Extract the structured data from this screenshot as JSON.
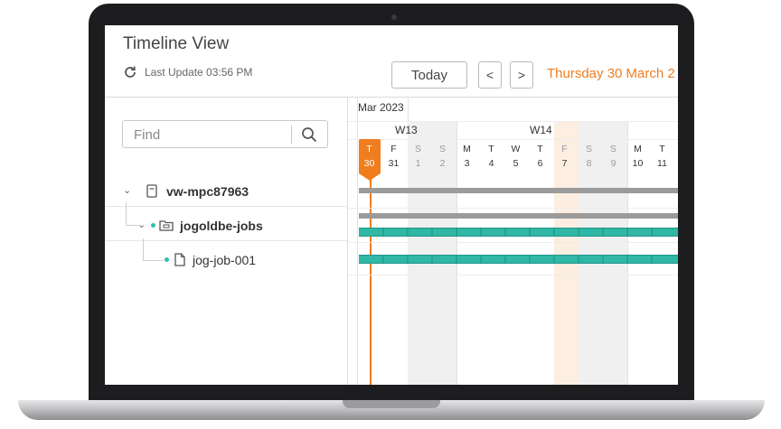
{
  "app": {
    "title": "Timeline View",
    "last_update": "Last Update 03:56 PM",
    "today_button": "Today",
    "prev_button": "<",
    "next_button": ">",
    "current_date": "Thursday 30 March 2"
  },
  "search": {
    "placeholder": "Find"
  },
  "tree": [
    {
      "label": "vw-mpc87963",
      "icon": "server-icon",
      "expanded": true
    },
    {
      "label": "jogoldbe-jobs",
      "icon": "folder-icon",
      "expanded": true
    },
    {
      "label": "jog-job-001",
      "icon": "file-icon"
    }
  ],
  "timeline": {
    "month": "Mar 2023",
    "weeks": [
      "W13",
      "W14"
    ],
    "day_letters": [
      "T",
      "F",
      "S",
      "S",
      "M",
      "T",
      "W",
      "T",
      "F",
      "S",
      "S",
      "M",
      "T"
    ],
    "day_numbers": [
      "30",
      "31",
      "1",
      "2",
      "3",
      "4",
      "5",
      "6",
      "7",
      "8",
      "9",
      "10",
      "11"
    ],
    "colors": {
      "accent": "#f07d1e",
      "job_bar": "#30b7a5",
      "group_bar": "#9b9b9b"
    }
  }
}
